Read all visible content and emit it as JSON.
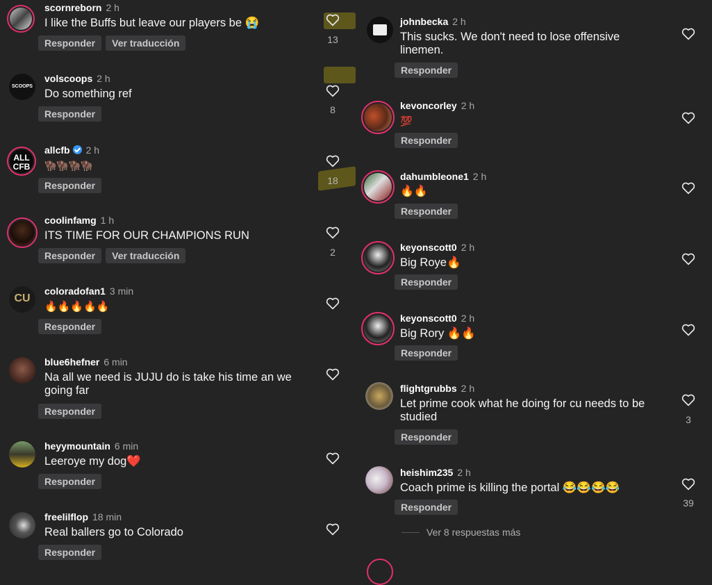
{
  "reply_label": "Responder",
  "translate_label": "Ver traducción",
  "left_comments": [
    {
      "user": "scornreborn",
      "time": "2 h",
      "text": "I like the Buffs but leave our players be 😭",
      "likes": "13",
      "translate": true
    },
    {
      "user": "volscoops",
      "time": "2 h",
      "text": "Do something ref",
      "likes": "8"
    },
    {
      "user": "allcfb",
      "time": "2 h",
      "text": "🦬🦬🦬🦬",
      "likes": "18",
      "verified": true
    },
    {
      "user": "coolinfamg",
      "time": "1 h",
      "text": "ITS TIME FOR OUR CHAMPIONS RUN",
      "likes": "2",
      "translate": true
    },
    {
      "user": "coloradofan1",
      "time": "3 min",
      "text": "🔥🔥🔥🔥🔥",
      "likes": ""
    },
    {
      "user": "blue6hefner",
      "time": "6 min",
      "text": "Na all we need is JUJU do is take his time an we going far",
      "likes": ""
    },
    {
      "user": "heyymountain",
      "time": "6 min",
      "text": "Leeroye my dog❤️",
      "likes": ""
    },
    {
      "user": "freelilflop",
      "time": "18 min",
      "text": "Real ballers go to Colorado",
      "likes": ""
    }
  ],
  "right_comments": [
    {
      "user": "johnbecka",
      "time": "2 h",
      "text": "This sucks. We don't need to lose offensive linemen.",
      "likes": ""
    },
    {
      "user": "kevoncorley",
      "time": "2 h",
      "text": "💯",
      "likes": ""
    },
    {
      "user": "dahumbleone1",
      "time": "2 h",
      "text": "🔥🔥",
      "likes": ""
    },
    {
      "user": "keyonscott0",
      "time": "2 h",
      "text": "Big Roye🔥",
      "likes": ""
    },
    {
      "user": "keyonscott0",
      "time": "2 h",
      "text": "Big Rory 🔥🔥",
      "likes": ""
    },
    {
      "user": "flightgrubbs",
      "time": "2 h",
      "text": "Let prime cook  what he doing for cu needs to be studied",
      "likes": "3"
    },
    {
      "user": "heishim235",
      "time": "2 h",
      "text": "Coach prime is killing the portal 😂😂😂😂",
      "likes": "39"
    }
  ],
  "more_replies": "Ver 8 respuestas más",
  "colors": {
    "background": "#242424",
    "pill": "#3a3a3c",
    "story_ring": "#e1306c",
    "verified": "#3897f0"
  }
}
